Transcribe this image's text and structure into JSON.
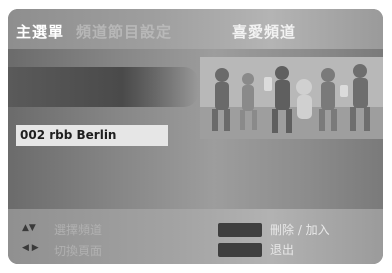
{
  "breadcrumb": {
    "main": "主選單",
    "middle": "頻道節目設定",
    "current": "喜愛頻道"
  },
  "channel": {
    "selected": "002 rbb Berlin"
  },
  "help": {
    "updown_icon": "▲▼",
    "leftright_icon": "◀ ▶",
    "line1_faint": "選擇頻道",
    "line2_faint": "切換頁面",
    "red_action": "刪除 / 加入",
    "exit_action": "退出"
  },
  "colors": {
    "selection_bg": "#e6e6e6",
    "button_swatch": "#3f3f3f"
  }
}
